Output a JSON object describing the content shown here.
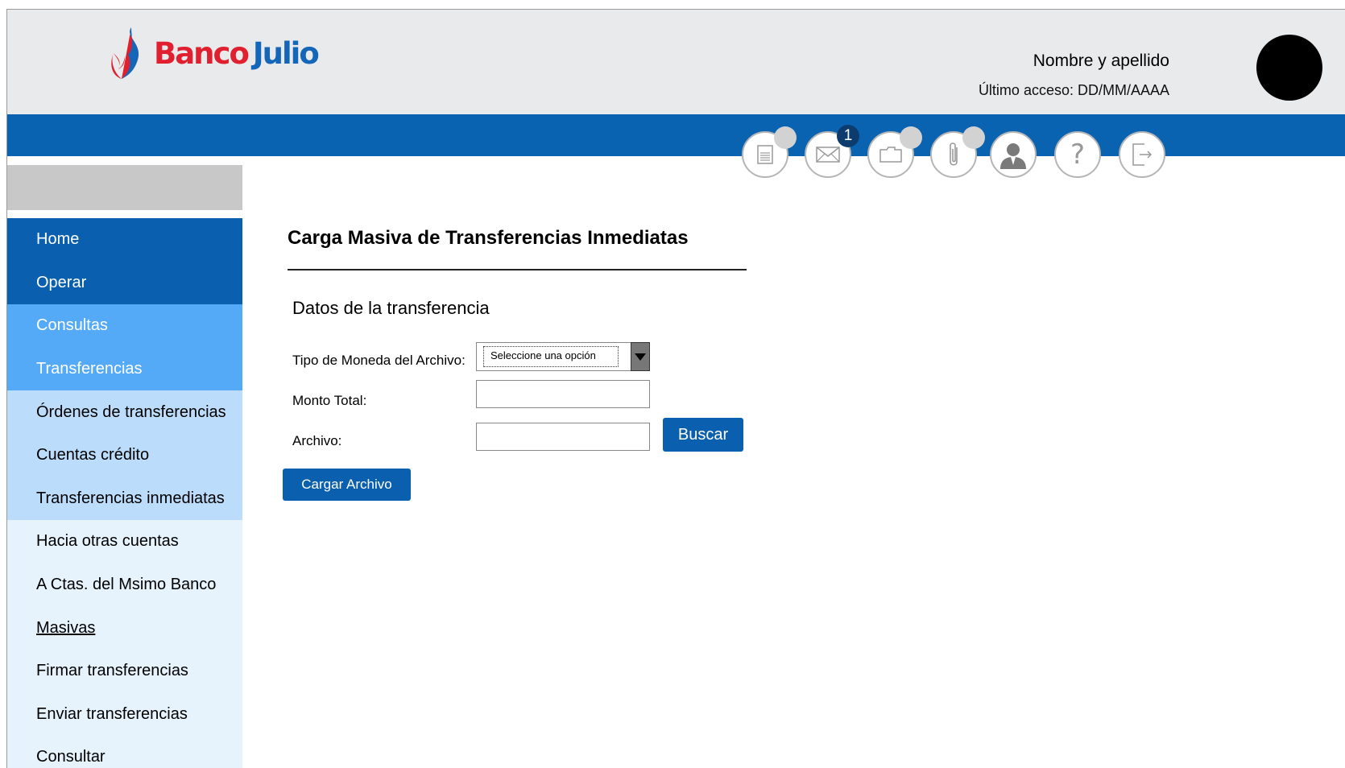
{
  "brand": {
    "name_part1": "Banco",
    "name_part2": "Julio",
    "colors": {
      "red": "#e0202e",
      "blue": "#1466b8"
    }
  },
  "header": {
    "user_name": "Nombre y apellido",
    "last_access": "Último acceso: DD/MM/AAAA"
  },
  "toolbar": [
    {
      "icon": "document-icon",
      "badge": ""
    },
    {
      "icon": "mail-icon",
      "badge": "1"
    },
    {
      "icon": "folder-icon",
      "badge": ""
    },
    {
      "icon": "paperclip-icon",
      "badge": ""
    },
    {
      "icon": "user-icon",
      "badge": null
    },
    {
      "icon": "help-icon",
      "badge": null
    },
    {
      "icon": "logout-icon",
      "badge": null
    }
  ],
  "sidebar": {
    "items": [
      {
        "label": "Home",
        "level": 1
      },
      {
        "label": "Operar",
        "level": 1
      },
      {
        "label": "Consultas",
        "level": 2
      },
      {
        "label": "Transferencias",
        "level": 2
      },
      {
        "label": "Órdenes de transferencias",
        "level": 3
      },
      {
        "label": "Cuentas crédito",
        "level": 3
      },
      {
        "label": "Transferencias inmediatas",
        "level": 3
      },
      {
        "label": "Hacia otras cuentas",
        "level": 4
      },
      {
        "label": "A Ctas. del Msimo Banco",
        "level": 4
      },
      {
        "label": "Masivas",
        "level": 4,
        "active": true
      },
      {
        "label": "Firmar transferencias",
        "level": 4
      },
      {
        "label": "Enviar transferencias",
        "level": 4
      },
      {
        "label": "Consultar",
        "level": 4
      }
    ]
  },
  "main": {
    "title": "Carga Masiva de Transferencias Inmediatas",
    "section_title": "Datos de la transferencia",
    "currency_label": "Tipo de Moneda del Archivo:",
    "currency_select": "Seleccione una opción",
    "amount_label": "Monto Total:",
    "amount_value": "",
    "file_label": "Archivo:",
    "file_value": "",
    "search_button": "Buscar",
    "upload_button": "Cargar Archivo"
  },
  "colors": {
    "header_bg": "#e9eaec",
    "band": "#0a63b1",
    "nav_level1": "#0a5fae",
    "nav_level2": "#55aaf7",
    "nav_level3": "#bcdcfb",
    "nav_level4": "#e6f3fd",
    "button": "#0a5fae"
  }
}
